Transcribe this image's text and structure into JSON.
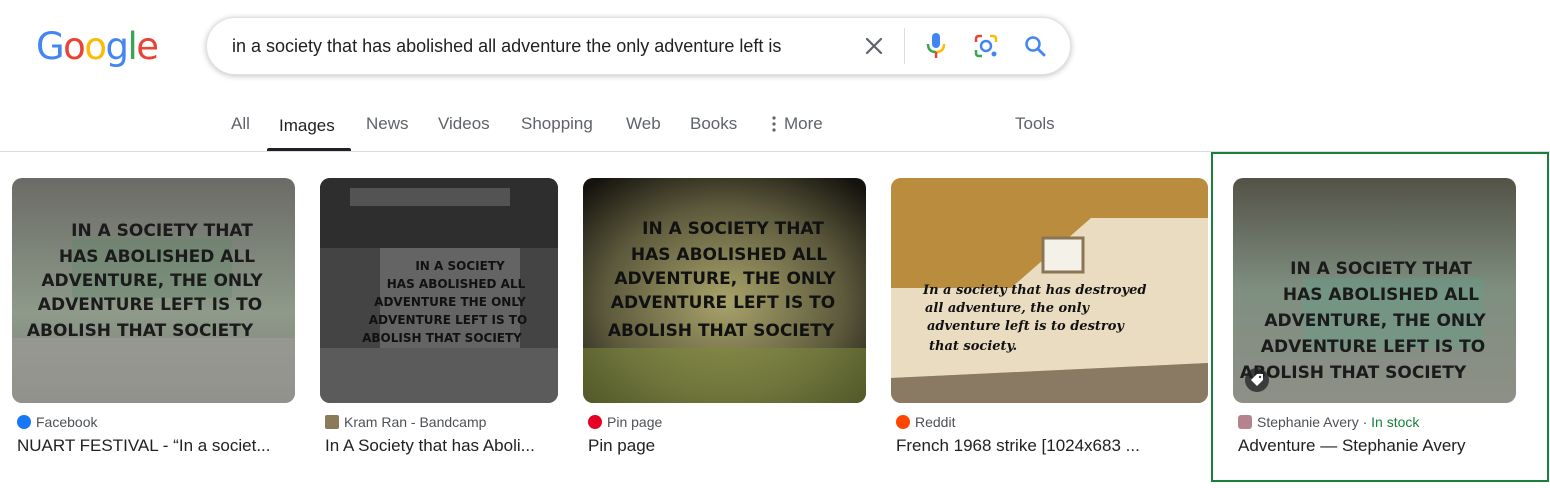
{
  "logo": {
    "letters": [
      "G",
      "o",
      "o",
      "g",
      "l",
      "e"
    ],
    "colors": [
      "#4285f4",
      "#ea4335",
      "#fbbc05",
      "#4285f4",
      "#34a853",
      "#ea4335"
    ]
  },
  "search": {
    "query": "in a society that has abolished all adventure the only adventure left is"
  },
  "tabs": [
    {
      "label": "All",
      "active": false
    },
    {
      "label": "Images",
      "active": true
    },
    {
      "label": "News",
      "active": false
    },
    {
      "label": "Videos",
      "active": false
    },
    {
      "label": "Shopping",
      "active": false
    },
    {
      "label": "Web",
      "active": false
    },
    {
      "label": "Books",
      "active": false
    },
    {
      "label": "More",
      "active": false
    }
  ],
  "tools_label": "Tools",
  "results": [
    {
      "source": "Facebook",
      "title": "NUART FESTIVAL - “In a societ...",
      "favicon": "facebook-icon",
      "favicon_color": "#1877f2",
      "image_lines": [
        "IN A SOCIETY THAT",
        "HAS ABOLISHED ALL",
        "ADVENTURE, THE ONLY",
        "ADVENTURE LEFT IS TO",
        "ABOLISH THAT SOCIETY"
      ]
    },
    {
      "source": "Kram Ran - Bandcamp",
      "title": "In A Society that has Aboli...",
      "favicon": "bandcamp-icon",
      "favicon_color": "#8c7b5a",
      "image_lines": [
        "IN A SOCIETY",
        "HAS ABOLISHED ALL",
        "ADVENTURE THE ONLY",
        "ADVENTURE LEFT IS TO",
        "ABOLISH THAT SOCIETY"
      ]
    },
    {
      "source": "Pin page",
      "title": "Pin page",
      "favicon": "pinterest-icon",
      "favicon_color": "#e60023",
      "image_lines": [
        "IN A SOCIETY THAT",
        "HAS ABOLISHED ALL",
        "ADVENTURE, THE ONLY",
        "ADVENTURE LEFT IS TO",
        "ABOLISH THAT SOCIETY"
      ]
    },
    {
      "source": "Reddit",
      "title": "French 1968 strike [1024x683 ...",
      "favicon": "reddit-icon",
      "favicon_color": "#ff4500",
      "image_lines": [
        "In a society that has destroyed",
        "all adventure, the only",
        "adventure left is to destroy",
        "that society."
      ]
    },
    {
      "source": "Stephanie Avery",
      "separator": " · ",
      "availability": "In stock",
      "title": "Adventure — Stephanie Avery",
      "favicon": "stephanie-avery-icon",
      "favicon_color": "#b5838d",
      "image_lines": [
        "IN A SOCIETY THAT",
        "HAS ABOLISHED ALL",
        "ADVENTURE, THE ONLY",
        "ADVENTURE LEFT IS TO",
        "ABOLISH THAT SOCIETY"
      ]
    }
  ]
}
